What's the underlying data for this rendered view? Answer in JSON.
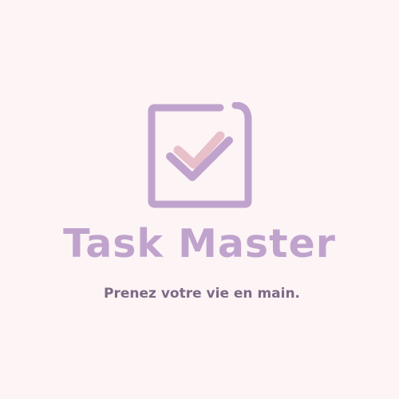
{
  "brand": {
    "name": "Task Master",
    "tagline": "Prenez votre vie en main."
  },
  "colors": {
    "background": "#fdf4f6",
    "box_purple": "#c0a3cd",
    "check_pink": "#e8c0c9",
    "check_purple": "#c0a3cd",
    "tagline": "#7d6a86"
  },
  "icons": {
    "logo_mark": "checkbox-check-icon"
  }
}
